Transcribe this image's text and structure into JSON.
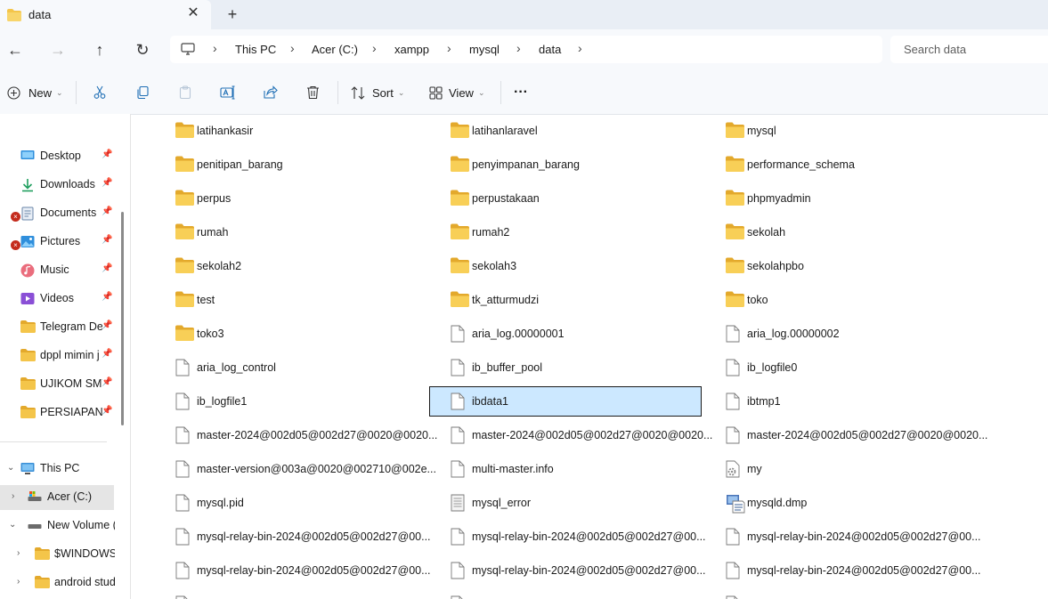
{
  "tab": {
    "title": "data",
    "close_glyph": "✕",
    "new_glyph": "+"
  },
  "nav": {
    "back_glyph": "←",
    "forward_glyph": "→",
    "up_glyph": "↑",
    "refresh_glyph": "↻",
    "breadcrumbs": [
      "This PC",
      "Acer (C:)",
      "xampp",
      "mysql",
      "data"
    ],
    "sep_glyph": "›",
    "search_placeholder": "Search data"
  },
  "toolbar": {
    "new_label": "New",
    "sort_label": "Sort",
    "view_label": "View",
    "more_label": "···"
  },
  "sidebar": {
    "quick": [
      {
        "label": "Desktop",
        "icon": "desktop-icon",
        "error": false
      },
      {
        "label": "Downloads",
        "icon": "download-icon",
        "error": false
      },
      {
        "label": "Documents",
        "icon": "documents-icon",
        "error": true
      },
      {
        "label": "Pictures",
        "icon": "pictures-icon",
        "error": true
      },
      {
        "label": "Music",
        "icon": "music-icon",
        "error": false
      },
      {
        "label": "Videos",
        "icon": "videos-icon",
        "error": false
      },
      {
        "label": "Telegram Des",
        "icon": "folder-icon",
        "error": false
      },
      {
        "label": "dppl mimin j",
        "icon": "folder-icon",
        "error": false
      },
      {
        "label": "UJIKOM SMT",
        "icon": "folder-icon",
        "error": false
      },
      {
        "label": "PERSIAPAN U",
        "icon": "folder-icon",
        "error": false
      }
    ],
    "this_pc": "This PC",
    "acer": "Acer (C:)",
    "new_volume": "New Volume (I",
    "windows": "$WINDOWS.~",
    "android": "android stud",
    "pin_glyph": "📌"
  },
  "items": [
    {
      "name": "latihankasir",
      "type": "folder"
    },
    {
      "name": "latihanlaravel",
      "type": "folder"
    },
    {
      "name": "mysql",
      "type": "folder"
    },
    {
      "name": "penitipan_barang",
      "type": "folder"
    },
    {
      "name": "penyimpanan_barang",
      "type": "folder"
    },
    {
      "name": "performance_schema",
      "type": "folder"
    },
    {
      "name": "perpus",
      "type": "folder"
    },
    {
      "name": "perpustakaan",
      "type": "folder"
    },
    {
      "name": "phpmyadmin",
      "type": "folder"
    },
    {
      "name": "rumah",
      "type": "folder"
    },
    {
      "name": "rumah2",
      "type": "folder"
    },
    {
      "name": "sekolah",
      "type": "folder"
    },
    {
      "name": "sekolah2",
      "type": "folder"
    },
    {
      "name": "sekolah3",
      "type": "folder"
    },
    {
      "name": "sekolahpbo",
      "type": "folder"
    },
    {
      "name": "test",
      "type": "folder"
    },
    {
      "name": "tk_atturmudzi",
      "type": "folder"
    },
    {
      "name": "toko",
      "type": "folder"
    },
    {
      "name": "toko3",
      "type": "folder"
    },
    {
      "name": "aria_log.00000001",
      "type": "file"
    },
    {
      "name": "aria_log.00000002",
      "type": "file"
    },
    {
      "name": "aria_log_control",
      "type": "file"
    },
    {
      "name": "ib_buffer_pool",
      "type": "file"
    },
    {
      "name": "ib_logfile0",
      "type": "file"
    },
    {
      "name": "ib_logfile1",
      "type": "file"
    },
    {
      "name": "ibdata1",
      "type": "file",
      "selected": true
    },
    {
      "name": "ibtmp1",
      "type": "file"
    },
    {
      "name": "master-2024@002d05@002d27@0020@0020...",
      "type": "file"
    },
    {
      "name": "master-2024@002d05@002d27@0020@0020...",
      "type": "file"
    },
    {
      "name": "master-2024@002d05@002d27@0020@0020...",
      "type": "file"
    },
    {
      "name": "master-version@003a@0020@002710@002e...",
      "type": "file"
    },
    {
      "name": "multi-master.info",
      "type": "file"
    },
    {
      "name": "my",
      "type": "config"
    },
    {
      "name": "mysql.pid",
      "type": "file"
    },
    {
      "name": "mysql_error",
      "type": "text"
    },
    {
      "name": "mysqld.dmp",
      "type": "dump"
    },
    {
      "name": "mysql-relay-bin-2024@002d05@002d27@00...",
      "type": "file"
    },
    {
      "name": "mysql-relay-bin-2024@002d05@002d27@00...",
      "type": "file"
    },
    {
      "name": "mysql-relay-bin-2024@002d05@002d27@00...",
      "type": "file"
    },
    {
      "name": "mysql-relay-bin-2024@002d05@002d27@00...",
      "type": "file"
    },
    {
      "name": "mysql-relay-bin-2024@002d05@002d27@00...",
      "type": "file"
    },
    {
      "name": "mysql-relay-bin-2024@002d05@002d27@00...",
      "type": "file"
    },
    {
      "name": "",
      "type": "file"
    },
    {
      "name": "",
      "type": "file"
    },
    {
      "name": "",
      "type": "file"
    }
  ],
  "colors": {
    "folder": "#f4c54a",
    "folder_dark": "#e3a92c",
    "selection": "#cce8ff",
    "accent": "#0067c0"
  }
}
